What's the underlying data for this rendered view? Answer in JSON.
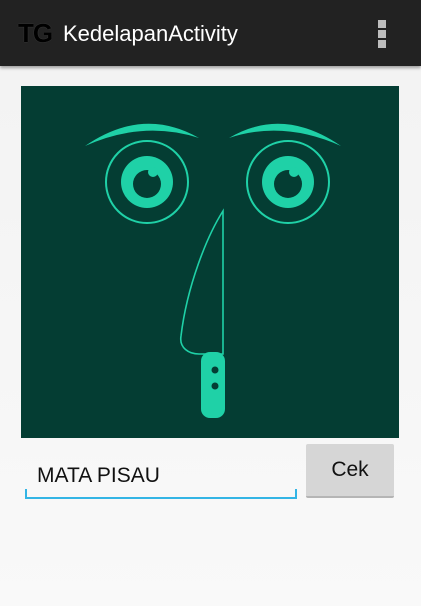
{
  "action_bar": {
    "logo_text": "TG",
    "title": "KedelapanActivity",
    "overflow_icon": "more-vertical-icon"
  },
  "puzzle": {
    "background_color": "#043d33",
    "drawing_color": "#1fd1a7",
    "depicts": [
      "eyebrow",
      "eye",
      "eye",
      "knife"
    ]
  },
  "answer": {
    "value": "MATA PISAU",
    "underline_color": "#33b5e5"
  },
  "check_button": {
    "label": "Cek"
  }
}
